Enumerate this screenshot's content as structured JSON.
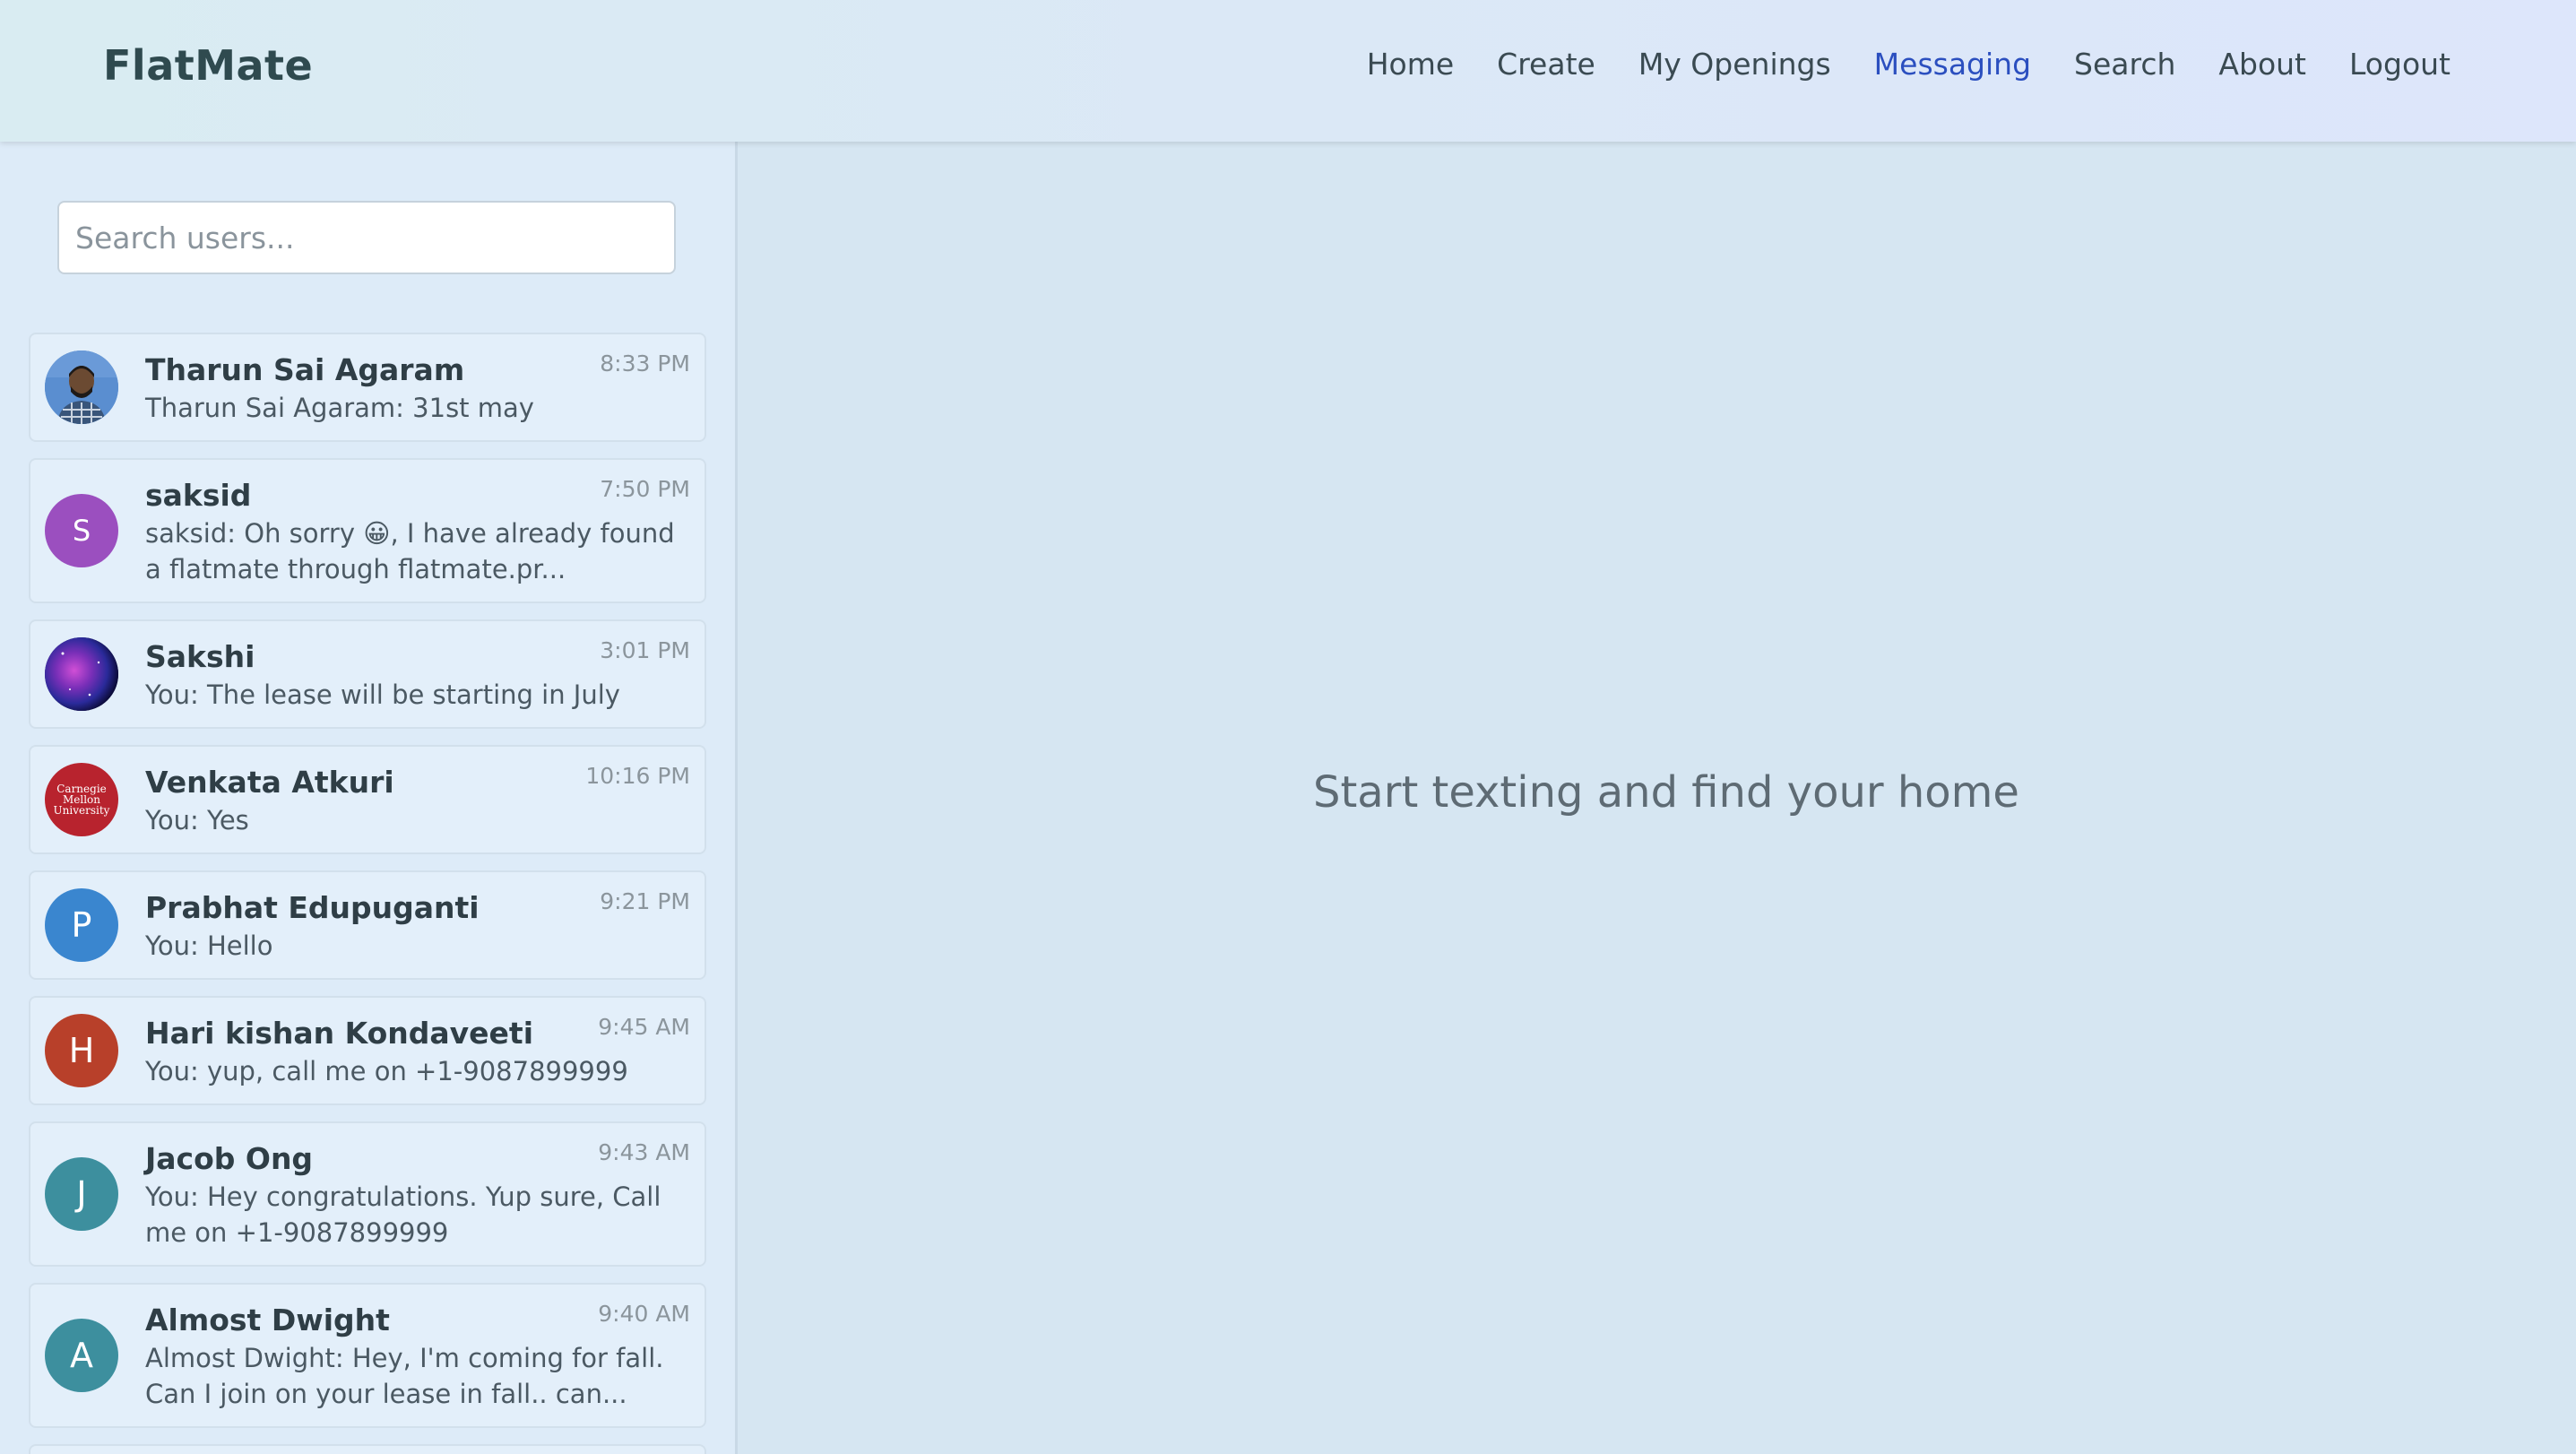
{
  "app": {
    "brand": "FlatMate"
  },
  "nav": {
    "links": [
      "Home",
      "Create",
      "My Openings",
      "Messaging",
      "Search",
      "About",
      "Logout"
    ],
    "active": "Messaging"
  },
  "sidebar": {
    "search_placeholder": "Search users...",
    "conversations": [
      {
        "name": "Tharun Sai Agaram",
        "time": "8:33 PM",
        "preview": "Tharun Sai Agaram: 31st may",
        "avatar": "photo",
        "initial": ""
      },
      {
        "name": "saksid",
        "time": "7:50 PM",
        "preview": "saksid: Oh sorry 😀, I have already found a flatmate through flatmate.pr...",
        "avatar": "letter",
        "initial": "S",
        "color": "#9b4fbf"
      },
      {
        "name": "Sakshi",
        "time": "3:01 PM",
        "preview": "You: The lease will be starting in July",
        "avatar": "galaxy",
        "initial": ""
      },
      {
        "name": "Venkata Atkuri",
        "time": "10:16 PM",
        "preview": "You: Yes",
        "avatar": "logo",
        "initial": "",
        "logo_text": "Carnegie Mellon University"
      },
      {
        "name": "Prabhat Edupuganti",
        "time": "9:21 PM",
        "preview": "You: Hello",
        "avatar": "letter",
        "initial": "P",
        "color": "#3a86cf"
      },
      {
        "name": "Hari kishan Kondaveeti",
        "time": "9:45 AM",
        "preview": "You: yup, call me on +1-9087899999",
        "avatar": "letter",
        "initial": "H",
        "color": "#b8402a"
      },
      {
        "name": "Jacob Ong",
        "time": "9:43 AM",
        "preview": "You: Hey congratulations. Yup sure, Call me on +1-9087899999",
        "avatar": "letter",
        "initial": "J",
        "color": "#3d8f9e"
      },
      {
        "name": "Almost Dwight",
        "time": "9:40 AM",
        "preview": "Almost Dwight: Hey, I'm coming for fall. Can I join on your lease in fall.. can...",
        "avatar": "letter",
        "initial": "A",
        "color": "#3d8f9e"
      }
    ]
  },
  "main": {
    "empty_message": "Start texting and find your home"
  }
}
